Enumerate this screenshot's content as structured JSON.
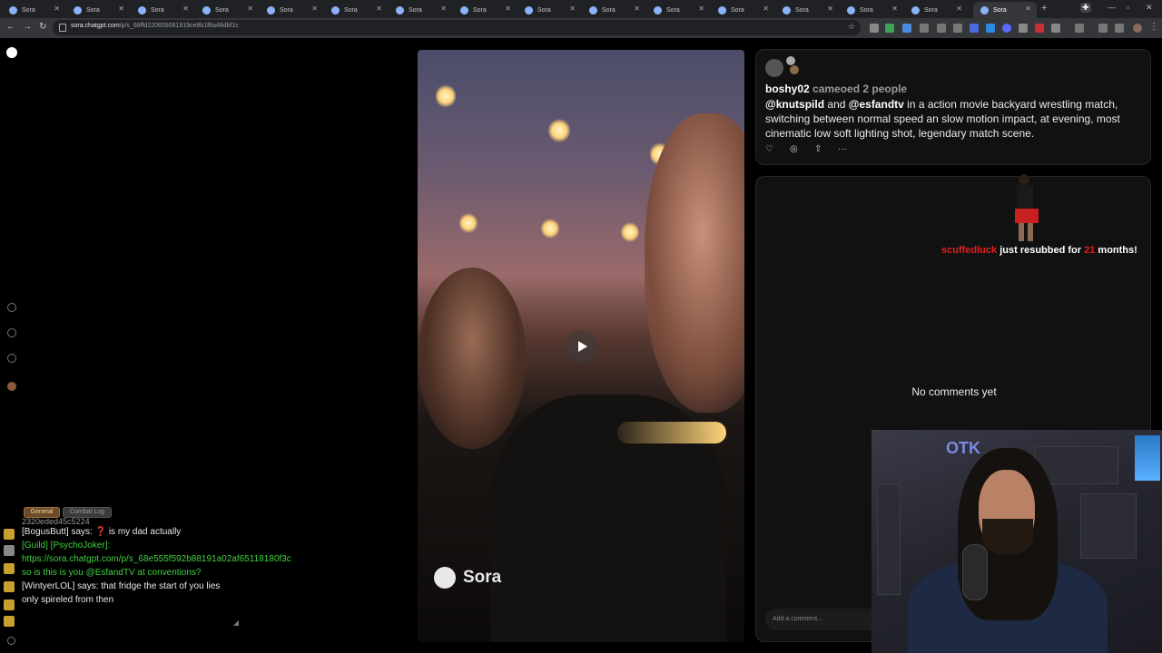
{
  "browser": {
    "tabs": [
      "Sora",
      "Sora",
      "Sora",
      "Sora",
      "Sora",
      "Sora",
      "Sora",
      "Sora",
      "Sora",
      "Sora",
      "Sora",
      "Sora",
      "Sora",
      "Sora",
      "Sora",
      "Sora"
    ],
    "active_tab_index": 15,
    "url_domain": "sora.chatgpt.com",
    "url_path": "/p/s_68ffd220655081919ce8b1f8a48dbf1c"
  },
  "video": {
    "watermark": "Sora",
    "play_icon": "play-icon"
  },
  "post": {
    "author": "boshy02",
    "meta": "cameoed 2 people",
    "mention_1": "@knutspild",
    "and": "and",
    "mention_2": "@esfandtv",
    "caption_rest": "in a action movie backyard wrestling match, switching between normal speed an slow motion impact, at evening, most cinematic low soft lighting shot, legendary match scene.",
    "actions": [
      "heart-icon",
      "remix-icon",
      "share-icon",
      "more-icon"
    ],
    "more_label": "···"
  },
  "comments": {
    "empty_text": "No comments yet",
    "input_placeholder": "Add a comment..."
  },
  "stream_alert": {
    "user": "scuffedluck",
    "text_1": "just resubbed for",
    "months": "21",
    "text_2": "months!"
  },
  "webcam": {
    "logo_text": "OTK"
  },
  "chat": {
    "tab_general": "General",
    "tab_combat": "Combat Log",
    "cut_line": "2320eded45c5224",
    "lines": [
      {
        "text": "[BogusButt] says: ❓ is my dad actually",
        "color": "white"
      },
      {
        "text": "[Guild] [PsychoJoker]: https://sora.chatgpt.com/p/s_68e555f592b88191a02af65118180f3c so is this is you @EsfandTV at conventions?",
        "color": "green"
      },
      {
        "text": "[WintyerLOL] says: that fridge the start of you lies only spireled from then",
        "color": "white"
      }
    ]
  },
  "colors": {
    "accent_red": "#e0201f",
    "guild_green": "#40d040"
  }
}
